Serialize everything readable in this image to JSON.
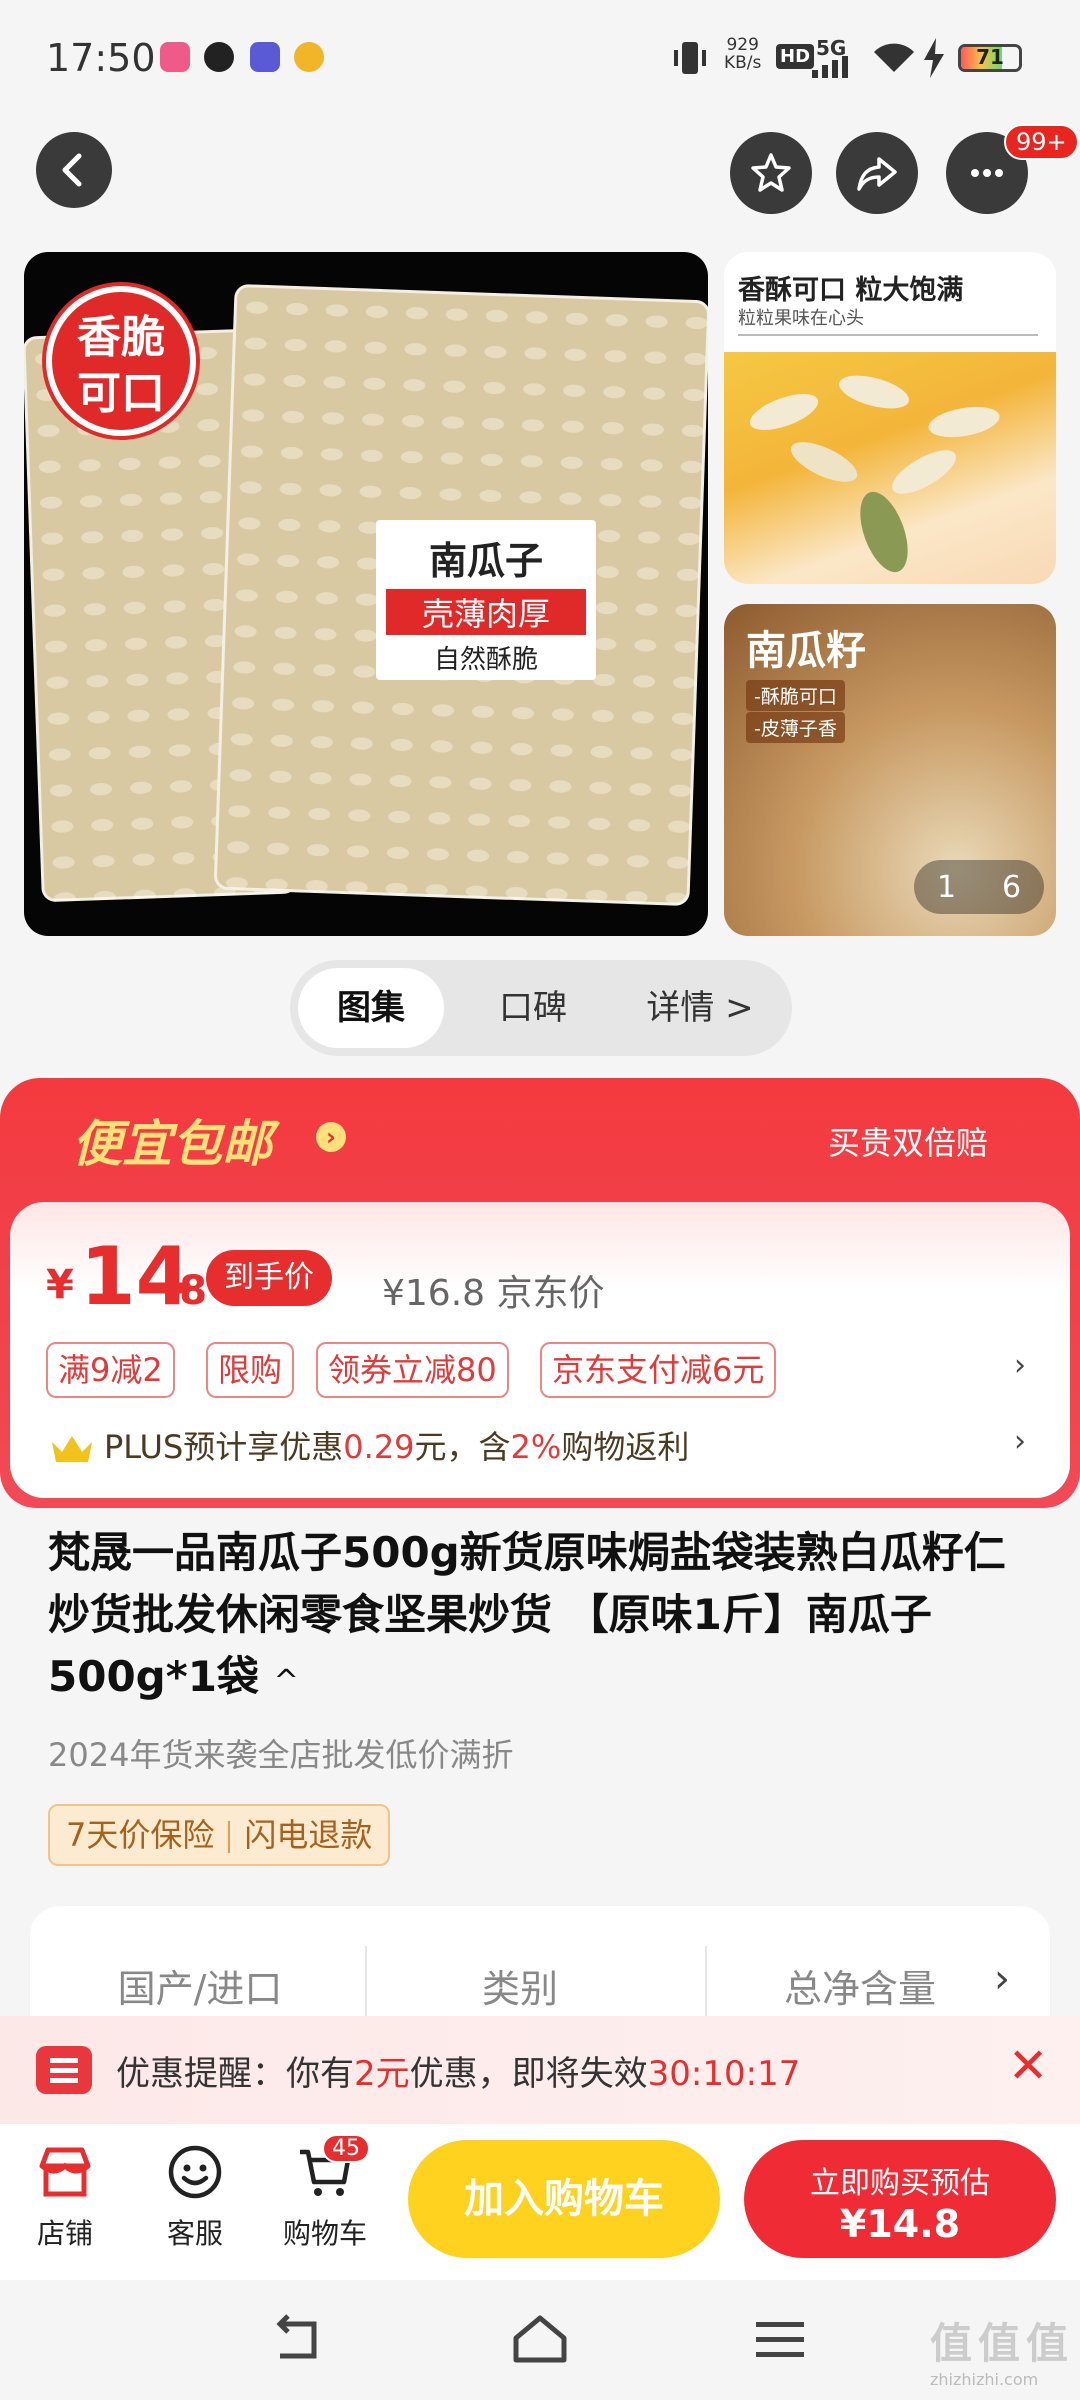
{
  "status_bar": {
    "time": "17:50",
    "net_speed_top": "929",
    "net_speed_unit": "KB/s",
    "hd": "HD",
    "signal": "5G",
    "battery": "71",
    "battery_level": 0.71
  },
  "header": {
    "more_badge": "99+"
  },
  "gallery": {
    "main_seal": "香脆\n可口",
    "main_label_title": "南瓜子",
    "main_label_red": "壳薄肉厚",
    "main_label_sub": "自然酥脆",
    "side1_title": "香酥可口 粒大饱满",
    "side1_sub": "粒粒果味在心头",
    "side2_title": "南瓜籽",
    "side2_tags": [
      "-酥脆可口",
      "-皮薄子香"
    ],
    "counter_current": "1",
    "counter_total": "6"
  },
  "tabs": [
    {
      "label": "图集"
    },
    {
      "label": "口碑"
    },
    {
      "label": "详情 >"
    }
  ],
  "promo": {
    "title": "便宜包邮",
    "right": "买贵双倍赔",
    "currency": "¥",
    "price_int": "14",
    "price_dec": ".8",
    "hand_price_label": "到手价",
    "orig_price": "¥16.8 京东价",
    "chips": [
      "满9减2",
      "限购",
      "领券立减80",
      "京东支付减6元"
    ],
    "plus_prefix": "PLUS预计享优惠",
    "plus_amount": "0.29",
    "plus_mid": "元，含",
    "plus_pct": "2%",
    "plus_suffix": "购物返利"
  },
  "product": {
    "title": "梵晟一品南瓜子500g新货原味焗盐袋装熟白瓜籽仁炒货批发休闲零食坚果炒货 【原味1斤】南瓜子500g*1袋",
    "collapse": "^",
    "subline": "2024年货来袭全店批发低价满折",
    "guarantees": [
      "7天价保险",
      "闪电退款"
    ]
  },
  "specs": [
    "国产/进口",
    "类别",
    "总净含量"
  ],
  "reminder": {
    "prefix": "优惠提醒：你有",
    "amount": "2元",
    "mid": "优惠，即将失效",
    "countdown": "30:10:17"
  },
  "bottom_bar": {
    "shop": "店铺",
    "service": "客服",
    "cart": "购物车",
    "cart_count": "45",
    "add_cart": "加入购物车",
    "buy_now_line1": "立即购买预估",
    "buy_now_line2": "¥14.8"
  },
  "watermark": {
    "text": "值值值",
    "domain": "zhizhizhi.com"
  },
  "colors": {
    "accent_red": "#e62e2e",
    "cart_yellow": "#ffd21f",
    "promo_title": "#ffe07a"
  }
}
